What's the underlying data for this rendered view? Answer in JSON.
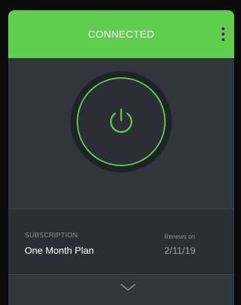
{
  "header": {
    "status": "CONNECTED",
    "menu_icon": "kebab-menu-icon"
  },
  "power": {
    "icon": "power-icon",
    "ring_color": "#5fce4f"
  },
  "subscription": {
    "label": "SUBSCRIPTION",
    "plan": "One Month Plan",
    "renews_label": "Renews on",
    "renew_date": "2/11/19"
  },
  "footer": {
    "expand_icon": "chevron-down-icon"
  },
  "colors": {
    "accent": "#5fce4f",
    "background": "#31353c",
    "panel": "#2b2f35"
  }
}
